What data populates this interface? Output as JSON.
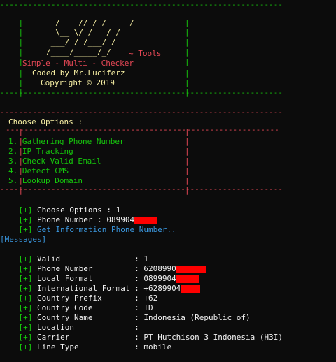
{
  "colors": {
    "background": "#0c0c0c",
    "green": "#16c60c",
    "red": "#e74856",
    "white": "#f2f2f2",
    "cyan": "#3a96dd",
    "redaction": "#ff0000"
  },
  "banner": {
    "border_rule": "-------------------------------------------------------------",
    "side_char": "|",
    "ascii_art": [
      "   _____ __  ________",
      "  / ___// / /_  __/",
      "  \\__ \\/ /   / /",
      " ___/ / /___/ /",
      "/____/_____/_/"
    ],
    "tools_suffix": "~ Tools",
    "subtitle": "Simple - Multi - Checker",
    "author": "Coded by Mr.Luciferz",
    "copyright": "Copyright © 2019"
  },
  "menu": {
    "rule": "-------------------------------------------------------------",
    "side_char": "|",
    "title": "Choose Options :",
    "inner_rule": "-----------------------------------------------------------",
    "options": [
      "1. Gathering Phone Number",
      "2. IP Tracking",
      "3. Check Valid Email",
      "4. Detect CMS",
      "5. Lookup Domain"
    ]
  },
  "prompt": {
    "marker": "[+]",
    "choose_label": "Choose Options : ",
    "choose_value": "1",
    "phone_label": "Phone Number : ",
    "phone_value": "089904",
    "status": "Get Information Phone Number.."
  },
  "messages": {
    "header": "[Messages]",
    "marker": "[+]",
    "rows": [
      {
        "label": "Valid                : ",
        "value": "1"
      },
      {
        "label": "Phone Number         : ",
        "value": "6208990"
      },
      {
        "label": "Local Format         : ",
        "value": "0899904"
      },
      {
        "label": "International Format : ",
        "value": "+6289904"
      },
      {
        "label": "Country Prefix       : ",
        "value": "+62"
      },
      {
        "label": "Country Code         : ",
        "value": "ID"
      },
      {
        "label": "Country Name         : ",
        "value": "Indonesia (Republic of)"
      },
      {
        "label": "Location             : ",
        "value": ""
      },
      {
        "label": "Carrier              : ",
        "value": "PT Hutchison 3 Indonesia (H3I)"
      },
      {
        "label": "Line Type            : ",
        "value": "mobile"
      }
    ]
  }
}
